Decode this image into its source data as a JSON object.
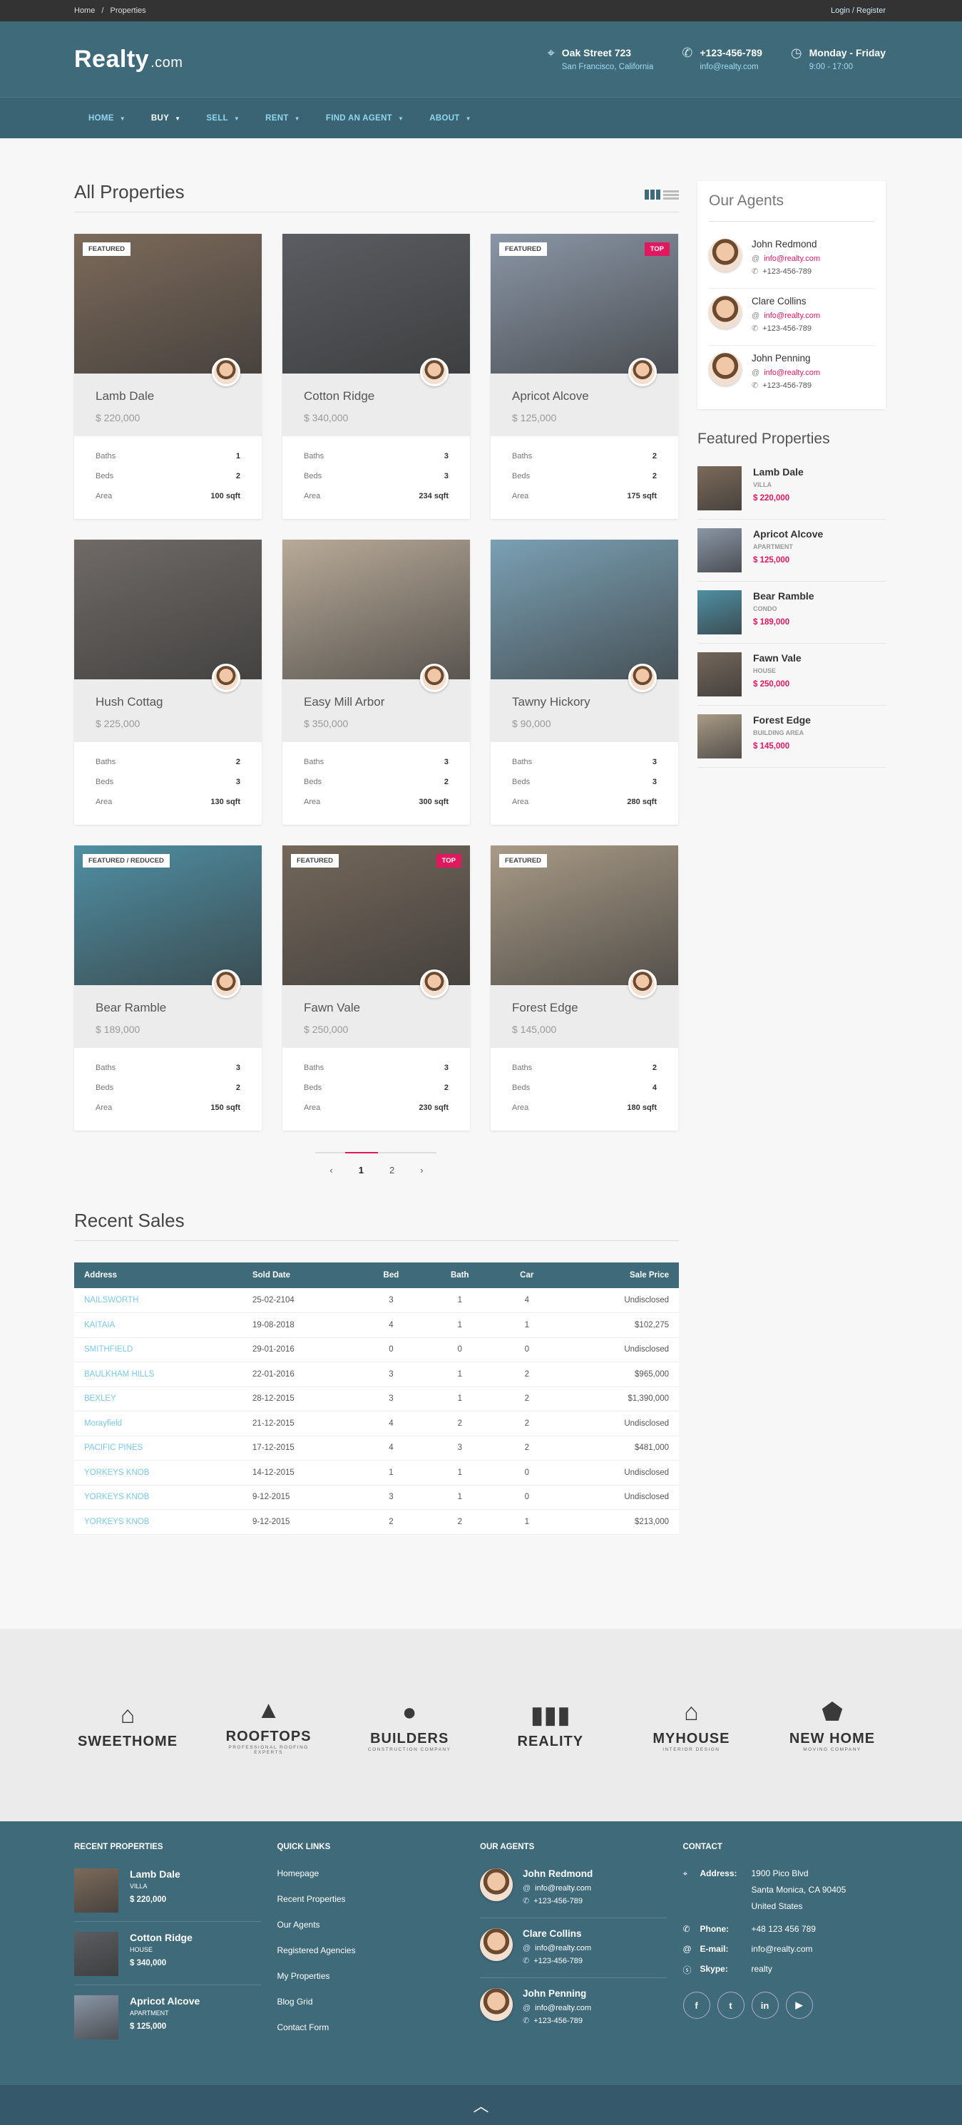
{
  "topbar": {
    "crumbs": [
      "Home",
      "/",
      "Properties"
    ],
    "login": "Login / Register"
  },
  "header": {
    "logo": "Realty",
    "logo_suffix": ".com",
    "info": [
      {
        "icon": "map-pin-icon",
        "line1": "Oak Street 723",
        "line2": "San Francisco, California"
      },
      {
        "icon": "phone-icon",
        "line1": "+123-456-789",
        "line2": "info@realty.com"
      },
      {
        "icon": "clock-icon",
        "line1": "Monday - Friday",
        "line2": "9:00 - 17:00"
      }
    ]
  },
  "nav": [
    "HOME",
    "BUY",
    "SELL",
    "RENT",
    "FIND AN AGENT",
    "ABOUT"
  ],
  "main": {
    "title": "All Properties",
    "properties": [
      {
        "name": "Lamb Dale",
        "price": "$ 220,000",
        "badge": "FEATURED",
        "top": "",
        "baths": "1",
        "beds": "2",
        "area": "100 sqft",
        "img": "#7c6a5a"
      },
      {
        "name": "Cotton Ridge",
        "price": "$ 340,000",
        "badge": "",
        "top": "",
        "baths": "3",
        "beds": "3",
        "area": "234 sqft",
        "img": "#5b5d62"
      },
      {
        "name": "Apricot Alcove",
        "price": "$ 125,000",
        "badge": "FEATURED",
        "top": "TOP",
        "baths": "2",
        "beds": "2",
        "area": "175 sqft",
        "img": "#8a96a6"
      },
      {
        "name": "Hush Cottag",
        "price": "$ 225,000",
        "badge": "",
        "top": "",
        "baths": "2",
        "beds": "3",
        "area": "130 sqft",
        "img": "#6f6a66"
      },
      {
        "name": "Easy Mill Arbor",
        "price": "$ 350,000",
        "badge": "",
        "top": "",
        "baths": "3",
        "beds": "2",
        "area": "300 sqft",
        "img": "#b8aa98"
      },
      {
        "name": "Tawny Hickory",
        "price": "$ 90,000",
        "badge": "",
        "top": "",
        "baths": "3",
        "beds": "3",
        "area": "280 sqft",
        "img": "#7aa0b4"
      },
      {
        "name": "Bear Ramble",
        "price": "$ 189,000",
        "badge": "FEATURED / REDUCED",
        "top": "",
        "baths": "3",
        "beds": "2",
        "area": "150 sqft",
        "img": "#4f8fa3"
      },
      {
        "name": "Fawn Vale",
        "price": "$ 250,000",
        "badge": "FEATURED",
        "top": "TOP",
        "baths": "3",
        "beds": "2",
        "area": "230 sqft",
        "img": "#74675a"
      },
      {
        "name": "Forest Edge",
        "price": "$ 145,000",
        "badge": "FEATURED",
        "top": "",
        "baths": "2",
        "beds": "4",
        "area": "180 sqft",
        "img": "#a89a86"
      }
    ],
    "spec_labels": {
      "baths": "Baths",
      "beds": "Beds",
      "area": "Area"
    },
    "pager": {
      "prev": "‹",
      "p1": "1",
      "p2": "2",
      "next": "›"
    },
    "recent_title": "Recent Sales",
    "table_headers": [
      "Address",
      "Sold Date",
      "Bed",
      "Bath",
      "Car",
      "Sale Price"
    ],
    "sales": [
      [
        "NAILSWORTH",
        "25-02-2104",
        "3",
        "1",
        "4",
        "Undisclosed"
      ],
      [
        "KAITAIA",
        "19-08-2018",
        "4",
        "1",
        "1",
        "$102,275"
      ],
      [
        "SMITHFIELD",
        "29-01-2016",
        "0",
        "0",
        "0",
        "Undisclosed"
      ],
      [
        "BAULKHAM HILLS",
        "22-01-2016",
        "3",
        "1",
        "2",
        "$965,000"
      ],
      [
        "BEXLEY",
        "28-12-2015",
        "3",
        "1",
        "2",
        "$1,390,000"
      ],
      [
        "Morayfield",
        "21-12-2015",
        "4",
        "2",
        "2",
        "Undisclosed"
      ],
      [
        "PACIFIC PINES",
        "17-12-2015",
        "4",
        "3",
        "2",
        "$481,000"
      ],
      [
        "YORKEYS KNOB",
        "14-12-2015",
        "1",
        "1",
        "0",
        "Undisclosed"
      ],
      [
        "YORKEYS KNOB",
        "9-12-2015",
        "3",
        "1",
        "0",
        "Undisclosed"
      ],
      [
        "YORKEYS KNOB",
        "9-12-2015",
        "2",
        "2",
        "1",
        "$213,000"
      ]
    ]
  },
  "sidebar": {
    "agents_title": "Our Agents",
    "agents": [
      {
        "name": "John Redmond",
        "email": "info@realty.com",
        "phone": "+123-456-789"
      },
      {
        "name": "Clare Collins",
        "email": "info@realty.com",
        "phone": "+123-456-789"
      },
      {
        "name": "John Penning",
        "email": "info@realty.com",
        "phone": "+123-456-789"
      }
    ],
    "featured_title": "Featured Properties",
    "featured": [
      {
        "name": "Lamb Dale",
        "type": "VILLA",
        "price": "$ 220,000",
        "img": "#7c6a5a"
      },
      {
        "name": "Apricot Alcove",
        "type": "APARTMENT",
        "price": "$ 125,000",
        "img": "#8a96a6"
      },
      {
        "name": "Bear Ramble",
        "type": "CONDO",
        "price": "$ 189,000",
        "img": "#4f8fa3"
      },
      {
        "name": "Fawn Vale",
        "type": "HOUSE",
        "price": "$ 250,000",
        "img": "#74675a"
      },
      {
        "name": "Forest Edge",
        "type": "BUILDING AREA",
        "price": "$ 145,000",
        "img": "#a89a86"
      }
    ]
  },
  "partners": [
    {
      "name": "SWEETHOME",
      "sub": ""
    },
    {
      "name": "ROOFTOPS",
      "sub": "PROFESSIONAL ROOFING EXPERTS"
    },
    {
      "name": "BUILDERS",
      "sub": "CONSTRUCTION COMPANY"
    },
    {
      "name": "REALITY",
      "sub": ""
    },
    {
      "name": "MYHOUSE",
      "sub": "INTERIOR DESIGN"
    },
    {
      "name": "NEW HOME",
      "sub": "MOVING COMPANY"
    }
  ],
  "footer": {
    "recent_title": "RECENT PROPERTIES",
    "recent": [
      {
        "name": "Lamb Dale",
        "type": "VILLA",
        "price": "$ 220,000",
        "img": "#7c6a5a"
      },
      {
        "name": "Cotton Ridge",
        "type": "HOUSE",
        "price": "$ 340,000",
        "img": "#5b5d62"
      },
      {
        "name": "Apricot Alcove",
        "type": "APARTMENT",
        "price": "$ 125,000",
        "img": "#8a96a6"
      }
    ],
    "links_title": "QUICK LINKS",
    "links": [
      "Homepage",
      "Recent Properties",
      "Our Agents",
      "Registered Agencies",
      "My Properties",
      "Blog Grid",
      "Contact Form"
    ],
    "agents_title": "OUR AGENTS",
    "agents": [
      {
        "name": "John Redmond",
        "email": "info@realty.com",
        "phone": "+123-456-789"
      },
      {
        "name": "Clare Collins",
        "email": "info@realty.com",
        "phone": "+123-456-789"
      },
      {
        "name": "John Penning",
        "email": "info@realty.com",
        "phone": "+123-456-789"
      }
    ],
    "contact_title": "CONTACT",
    "address_label": "Address:",
    "address_lines": [
      "1900 Pico Blvd",
      "Santa Monica, CA 90405",
      "United States"
    ],
    "phone_label": "Phone:",
    "phone": "+48 123 456 789",
    "email_label": "E-mail:",
    "email": "info@realty.com",
    "skype_label": "Skype:",
    "skype": "realty",
    "social": [
      "f",
      "t",
      "in",
      "▶"
    ]
  },
  "backtop": "︿"
}
